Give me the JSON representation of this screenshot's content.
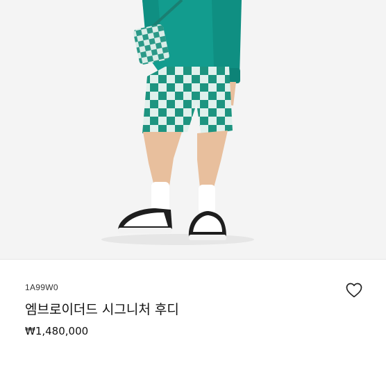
{
  "product": {
    "sku": "1A99W0",
    "name": "엠브로이더드 시그니처 후디",
    "price": "₩1,480,000"
  },
  "image": {
    "alt": "product-photo",
    "colors": {
      "hoodie": "#129c8e",
      "check_dark": "#1d9480",
      "check_light": "#dff0ec",
      "background": "#f4f4f4",
      "skin": "#e8bf9d"
    }
  },
  "icons": {
    "wishlist": "heart-outline-icon"
  }
}
